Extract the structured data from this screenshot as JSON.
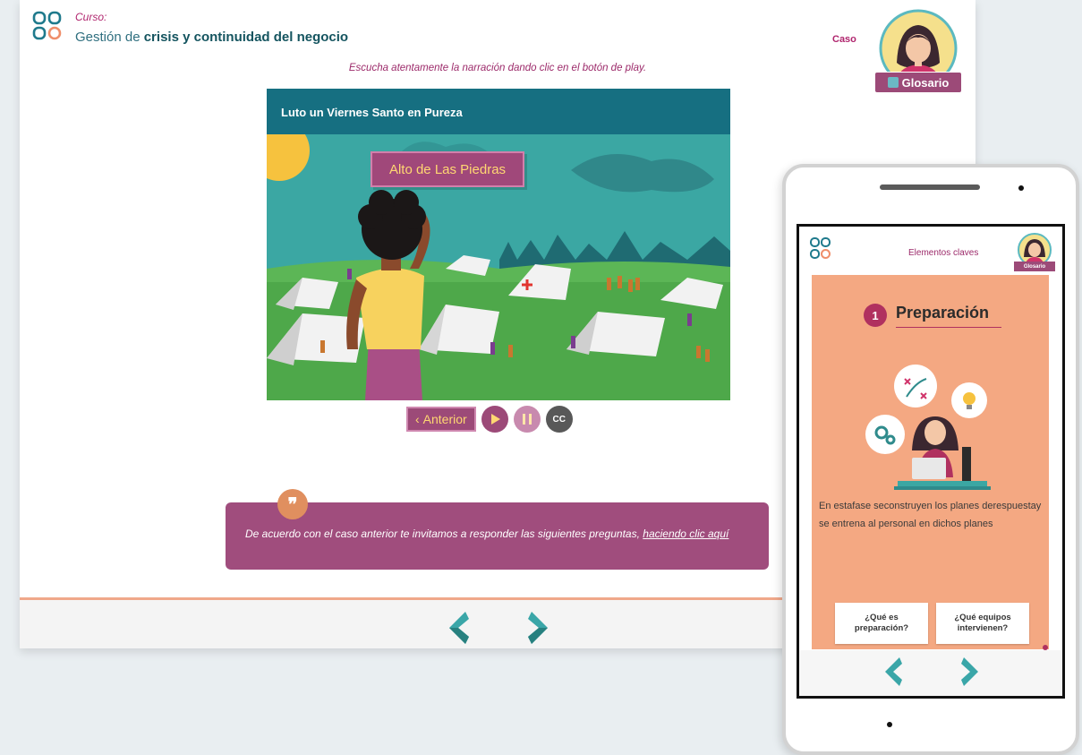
{
  "desktop": {
    "course_label": "Curso:",
    "course_title_pre": "Gestión de ",
    "course_title_bold": "crisis y continuidad del negocio",
    "caso_label": "Caso",
    "glosario_label": "Glosario",
    "instruction": "Escucha atentamente la narración dando clic en el botón de play.",
    "slide_title": "Luto un Viernes Santo en Pureza",
    "place_tag": "Alto de Las Piedras",
    "prev_button": "Anterior",
    "cc_button": "CC",
    "quote_text": "De acuerdo con el caso anterior te invitamos a responder las siguientes preguntas, ",
    "quote_link": "haciendo clic aquí"
  },
  "mobile": {
    "header": "Elementos claves",
    "glosario_label": "Glosario",
    "step_number": "1",
    "step_title": "Preparación",
    "body_text": "En estafase seconstruyen los planes derespuestay se entrena al personal en dichos planes",
    "button_1": "¿Qué es preparación?",
    "button_2": "¿Qué equipos intervienen?"
  },
  "colors": {
    "accent": "#9c4a78",
    "teal": "#166f81",
    "arrow": "#3aa6a8",
    "peach": "#f4a882"
  }
}
